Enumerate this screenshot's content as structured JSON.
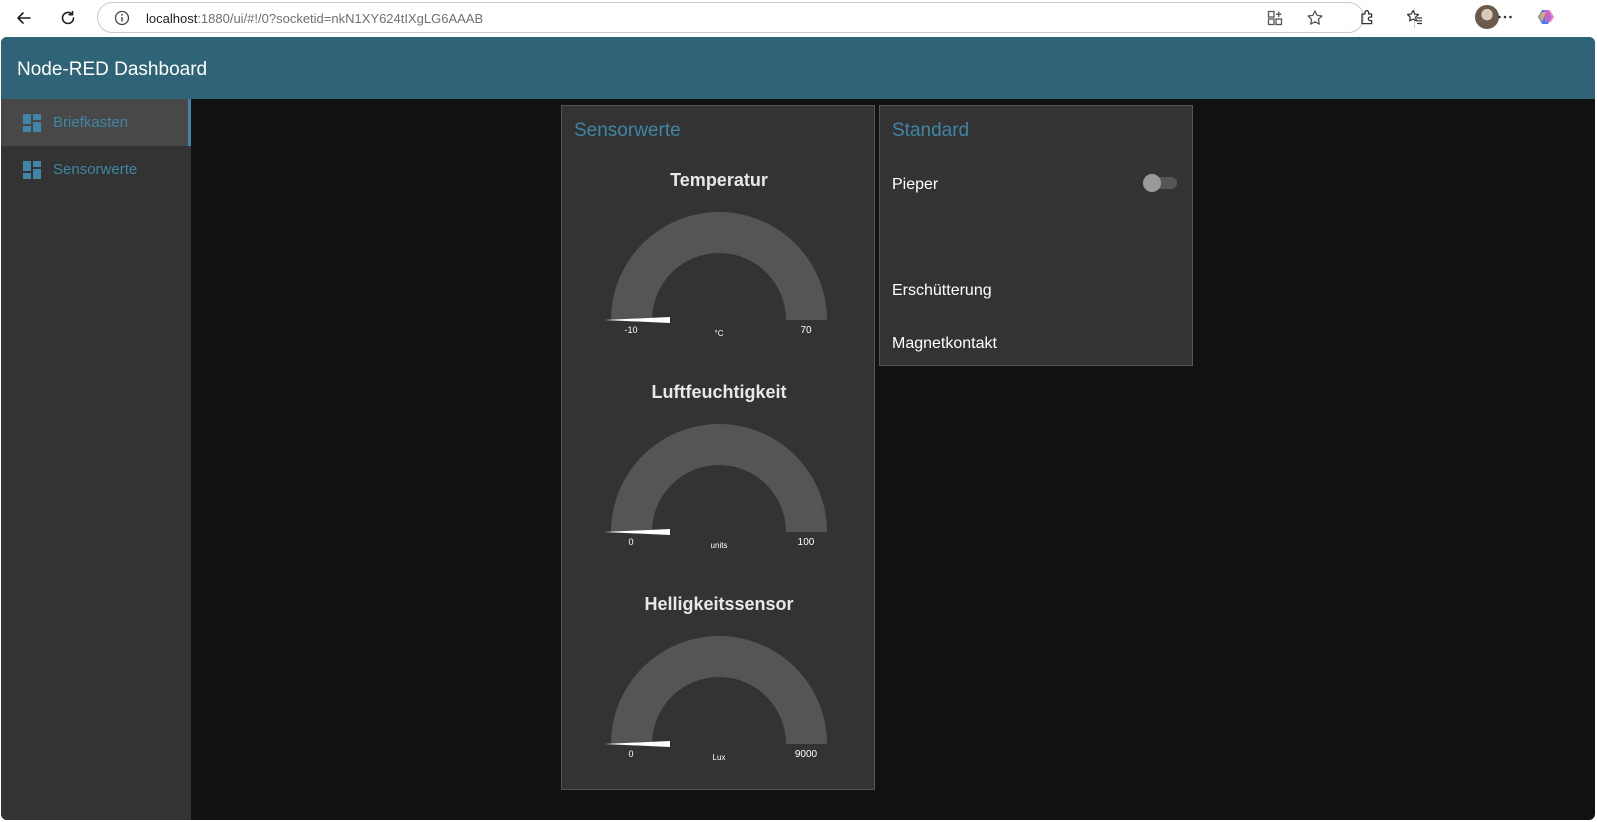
{
  "browser": {
    "url_host": "localhost",
    "url_rest": ":1880/ui/#!/0?socketid=nkN1XY624tIXgLG6AAAB"
  },
  "toolbar": {
    "title": "Node-RED Dashboard"
  },
  "sidenav": {
    "items": [
      {
        "label": "Briefkasten",
        "icon": "dashboard-icon",
        "active": true
      },
      {
        "label": "Sensorwerte",
        "icon": "dashboard-icon",
        "active": false
      }
    ]
  },
  "sensor_group": {
    "title": "Sensorwerte",
    "gauges": [
      {
        "title": "Temperatur",
        "min": "-10",
        "max": "70",
        "unit": "°C",
        "value": -10
      },
      {
        "title": "Luftfeuchtigkeit",
        "min": "0",
        "max": "100",
        "unit": "units",
        "value": 0
      },
      {
        "title": "Helligkeitssensor",
        "min": "0",
        "max": "9000",
        "unit": "Lux",
        "value": 0
      }
    ]
  },
  "standard_group": {
    "title": "Standard",
    "switch_label": "Pieper",
    "switch_on": false,
    "text1": "Erschütterung",
    "text2": "Magnetkontakt"
  },
  "colors": {
    "header": "#2f6377",
    "accent": "#3f86a6",
    "panel": "#333333",
    "background": "#111111",
    "gauge_track": "#555555"
  }
}
